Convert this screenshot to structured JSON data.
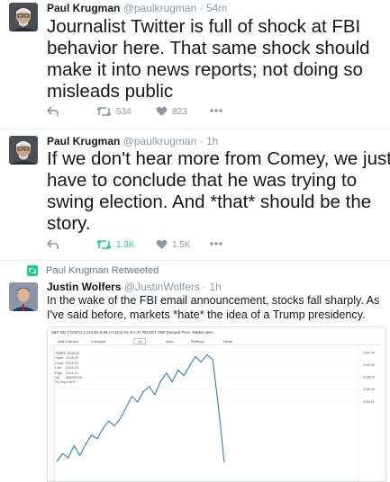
{
  "tweets": [
    {
      "name": "Paul Krugman",
      "handle": "@paulkrugman",
      "time": "54m",
      "text": "Journalist Twitter is full of shock at FBI behavior here. That same shock should make it into news reports; not doing so misleads public",
      "retweets": "534",
      "likes": "823"
    },
    {
      "name": "Paul Krugman",
      "handle": "@paulkrugman",
      "time": "1h",
      "text": "If we don't hear more from Comey, we just have to conclude that he was trying to swing election. And *that* should be the story.",
      "retweets": "1.3K",
      "likes": "1.5K"
    },
    {
      "retweeted_by": "Paul Krugman Retweeted",
      "name": "Justin Wolfers",
      "handle": "@JustinWolfers",
      "time": "1h",
      "text": "In the wake of the FBI email announcement, stocks fall sharply. As I've said before, markets *hate* the idea of a Trump presidency."
    }
  ],
  "sep": "·",
  "chart": {
    "header": "S&P 500 (^GSPC)  2,124.38  -8.08 (-0.41%)  As of 1:47 PM EDT. SNP Delayed Price. Market open.",
    "toolbar": [
      "Add Indicator",
      "Compare",
      "1d",
      "Area",
      "Settings",
      "Reset"
    ],
    "tooltip": {
      "symbol": "^GSPC 2124.11",
      "rows": [
        [
          "Open",
          "2124.05"
        ],
        [
          "Close",
          "2124.11"
        ],
        [
          "Low",
          "2124.03"
        ],
        [
          "High",
          "2124.11"
        ],
        [
          "Vol",
          "468269.69"
        ],
        [
          "% Chg",
          "0.06%"
        ]
      ]
    },
    "y_ticks": [
      "2142.00",
      "2140.00",
      "2138.00",
      "2136.00",
      "2134.00"
    ]
  },
  "chart_data": {
    "type": "line",
    "y": [
      2124.2,
      2125.5,
      2124.8,
      2126.8,
      2125.2,
      2127.0,
      2128.5,
      2127.9,
      2129.6,
      2130.8,
      2130.0,
      2131.2,
      2133.0,
      2134.8,
      2133.9,
      2135.6,
      2136.4,
      2135.1,
      2137.3,
      2138.6,
      2137.2,
      2139.1,
      2138.2,
      2139.8,
      2141.3,
      2140.4,
      2141.6,
      2140.8,
      2133.0,
      2124.1
    ]
  },
  "colors": {
    "retweet_active": "#19cf86",
    "chart_line": "#2b7ec8",
    "muted": "#8899a6"
  }
}
